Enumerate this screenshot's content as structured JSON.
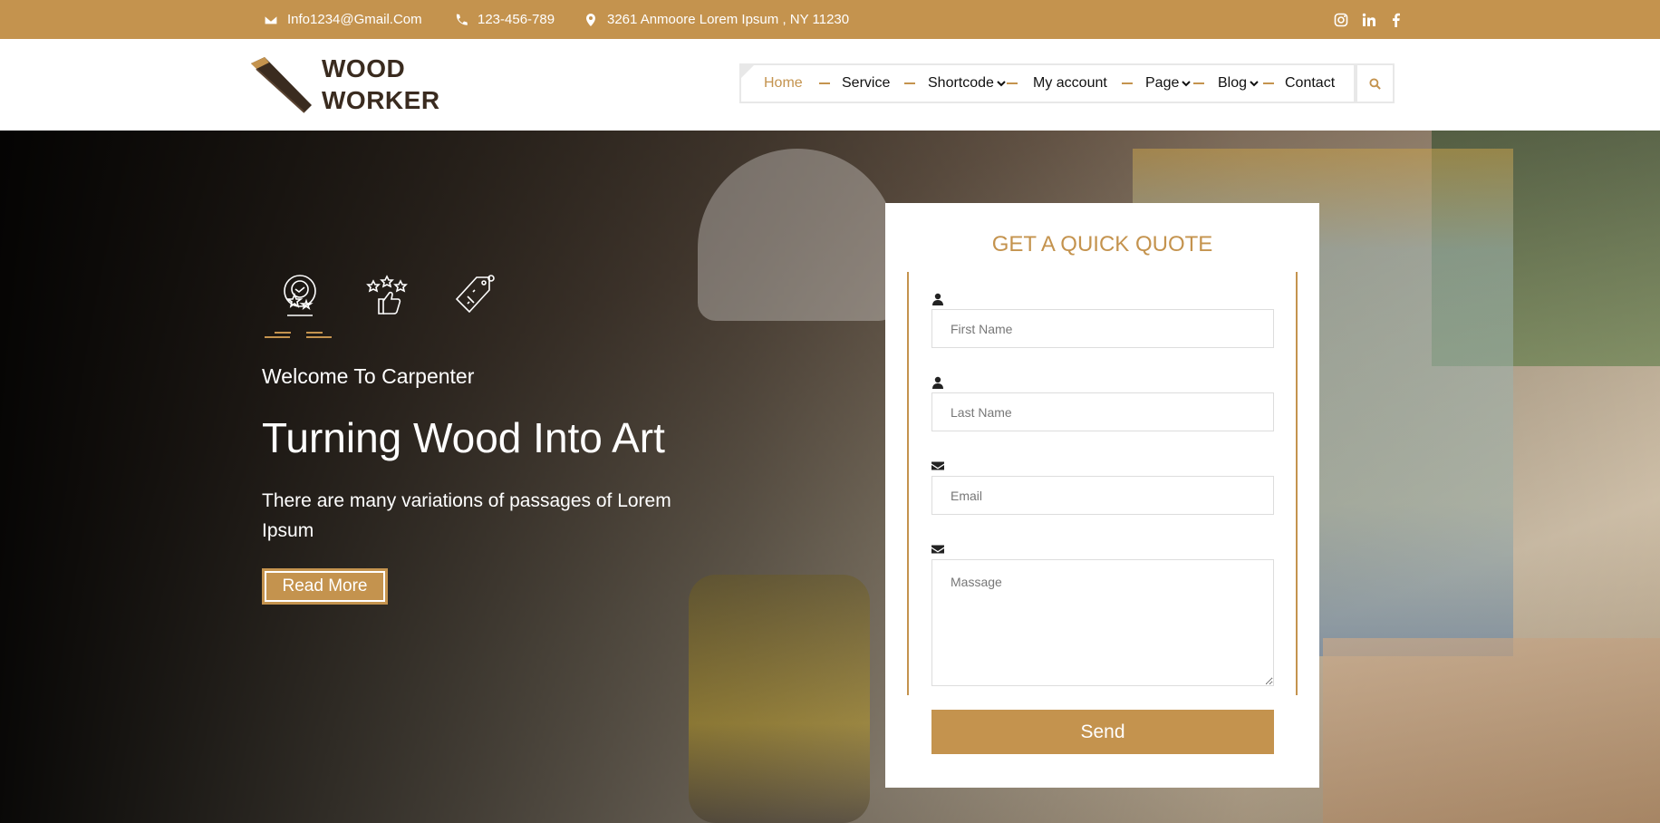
{
  "topbar": {
    "email": "Info1234@Gmail.Com",
    "phone": "123-456-789",
    "address": "3261 Anmoore Lorem Ipsum , NY 11230",
    "social": [
      "instagram-icon",
      "linkedin-icon",
      "facebook-icon"
    ]
  },
  "brand": {
    "line1": "WOOD",
    "line2": "WORKER"
  },
  "nav": {
    "items": [
      {
        "label": "Home",
        "active": true
      },
      {
        "label": "Service"
      },
      {
        "label": "Shortcode",
        "dropdown": true
      },
      {
        "label": "My account"
      },
      {
        "label": "Page",
        "dropdown": true
      },
      {
        "label": "Blog",
        "dropdown": true
      },
      {
        "label": "Contact"
      }
    ]
  },
  "hero": {
    "welcome": "Welcome To Carpenter",
    "title": "Turning Wood Into Art",
    "description": "There are many variations of passages of Lorem Ipsum",
    "read_more": "Read More",
    "feature_icons": [
      "award-badge-icon",
      "thumbs-up-stars-icon",
      "price-tag-icon"
    ]
  },
  "quote": {
    "title": "GET A QUICK QUOTE",
    "first_name_placeholder": "First Name",
    "last_name_placeholder": "Last Name",
    "email_placeholder": "Email",
    "message_placeholder": "Massage",
    "send_label": "Send"
  },
  "colors": {
    "accent": "#c4934e",
    "dark": "#3a2b1f"
  }
}
